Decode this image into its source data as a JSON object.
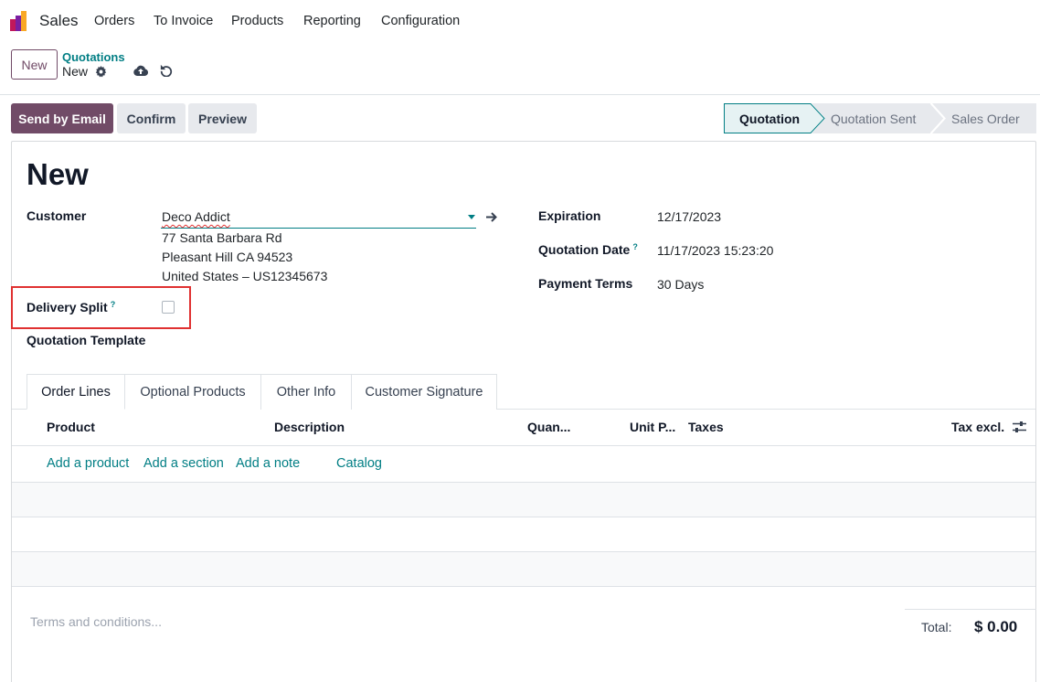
{
  "navbar": {
    "app_name": "Sales",
    "menu": [
      "Orders",
      "To Invoice",
      "Products",
      "Reporting",
      "Configuration"
    ]
  },
  "control_panel": {
    "new_label": "New",
    "breadcrumb_parent": "Quotations",
    "breadcrumb_current": "New"
  },
  "actions": {
    "send_by_email": "Send by Email",
    "confirm": "Confirm",
    "preview": "Preview"
  },
  "status": {
    "stages": [
      "Quotation",
      "Quotation Sent",
      "Sales Order"
    ],
    "active": "Quotation"
  },
  "form": {
    "title": "New",
    "customer_label": "Customer",
    "customer_value": "Deco Addict",
    "address_line1": "77 Santa Barbara Rd",
    "address_line2": "Pleasant Hill CA 94523",
    "address_line3": "United States – US12345673",
    "delivery_split_label": "Delivery Split",
    "help_mark": "?",
    "quotation_template_label": "Quotation Template",
    "expiration_label": "Expiration",
    "expiration_value": "12/17/2023",
    "quotation_date_label": "Quotation Date",
    "quotation_date_value": "11/17/2023 15:23:20",
    "payment_terms_label": "Payment Terms",
    "payment_terms_value": "30 Days"
  },
  "tabs": [
    "Order Lines",
    "Optional Products",
    "Other Info",
    "Customer Signature"
  ],
  "table": {
    "columns": [
      "Product",
      "Description",
      "Quan...",
      "Unit P...",
      "Taxes",
      "Tax excl."
    ],
    "add_links": [
      "Add a product",
      "Add a section",
      "Add a note",
      "Catalog"
    ]
  },
  "footer": {
    "terms_placeholder": "Terms and conditions...",
    "total_label": "Total:",
    "total_value": "$ 0.00"
  },
  "colors": {
    "brand": "#714b67",
    "link": "#017e84",
    "highlight": "#e03131"
  }
}
